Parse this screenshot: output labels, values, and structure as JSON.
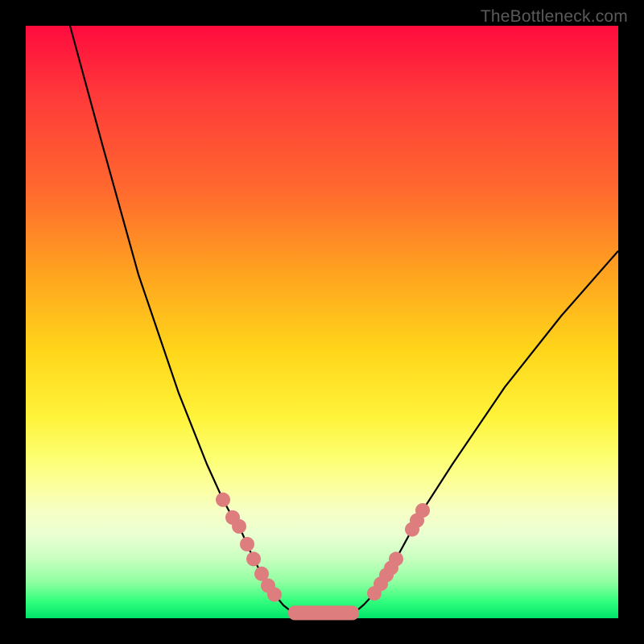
{
  "watermark": "TheBottleneck.com",
  "colors": {
    "dot": "#dd7d7d",
    "curve": "#000000",
    "frame": "#000000"
  },
  "chart_data": {
    "type": "line",
    "title": "",
    "xlabel": "",
    "ylabel": "",
    "xlim": [
      0,
      736
    ],
    "ylim_percent": [
      0,
      100
    ],
    "note": "V-shaped bottleneck curve; y is approximate bottleneck % (0 at trough, ~100 at top). Pink markers are sample points along the curve; a pink bar marks the flat optimal zone.",
    "series": [
      {
        "name": "left-branch",
        "points": [
          {
            "x": 55,
            "y": 100
          },
          {
            "x": 95,
            "y": 80
          },
          {
            "x": 140,
            "y": 58
          },
          {
            "x": 190,
            "y": 38
          },
          {
            "x": 225,
            "y": 26
          },
          {
            "x": 245,
            "y": 20
          },
          {
            "x": 257,
            "y": 17
          },
          {
            "x": 265,
            "y": 15.5
          },
          {
            "x": 275,
            "y": 12.5
          },
          {
            "x": 283,
            "y": 10
          },
          {
            "x": 293,
            "y": 7.5
          },
          {
            "x": 301,
            "y": 5.5
          },
          {
            "x": 309,
            "y": 4
          },
          {
            "x": 320,
            "y": 2.2
          },
          {
            "x": 332,
            "y": 0.9
          }
        ]
      },
      {
        "name": "right-branch",
        "points": [
          {
            "x": 408,
            "y": 0.9
          },
          {
            "x": 420,
            "y": 2.3
          },
          {
            "x": 433,
            "y": 4.2
          },
          {
            "x": 441,
            "y": 5.8
          },
          {
            "x": 448,
            "y": 7.3
          },
          {
            "x": 454,
            "y": 8.5
          },
          {
            "x": 460,
            "y": 10
          },
          {
            "x": 472,
            "y": 13
          },
          {
            "x": 480,
            "y": 15
          },
          {
            "x": 486,
            "y": 16.5
          },
          {
            "x": 493,
            "y": 18.2
          },
          {
            "x": 530,
            "y": 26
          },
          {
            "x": 595,
            "y": 39
          },
          {
            "x": 665,
            "y": 51
          },
          {
            "x": 736,
            "y": 62
          }
        ]
      }
    ],
    "trough_bar": {
      "x_start": 332,
      "x_end": 408,
      "y": 0.9
    },
    "markers_left": [
      {
        "x": 245,
        "y": 20
      },
      {
        "x": 257,
        "y": 17
      },
      {
        "x": 265,
        "y": 15.5
      },
      {
        "x": 275,
        "y": 12.5
      },
      {
        "x": 283,
        "y": 10
      },
      {
        "x": 293,
        "y": 7.5
      },
      {
        "x": 301,
        "y": 5.5
      },
      {
        "x": 309,
        "y": 4
      }
    ],
    "markers_right": [
      {
        "x": 433,
        "y": 4.2
      },
      {
        "x": 441,
        "y": 5.8
      },
      {
        "x": 448,
        "y": 7.3
      },
      {
        "x": 454,
        "y": 8.5
      },
      {
        "x": 460,
        "y": 10
      },
      {
        "x": 480,
        "y": 15
      },
      {
        "x": 486,
        "y": 16.5
      },
      {
        "x": 493,
        "y": 18.2
      }
    ]
  }
}
